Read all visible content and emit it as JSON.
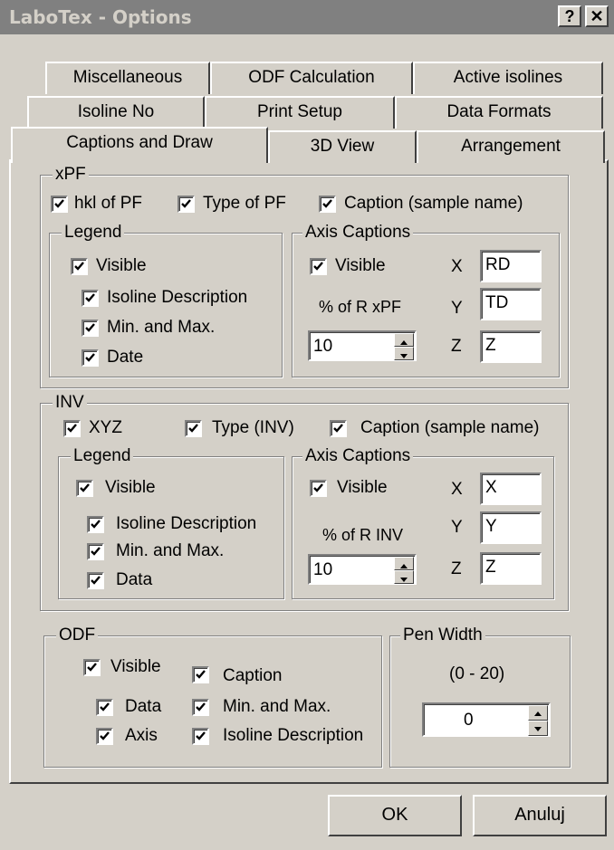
{
  "window": {
    "title": "LaboTex - Options",
    "help_label": "?",
    "close_label": "✕"
  },
  "tabs": {
    "row1": [
      "Miscellaneous",
      "ODF Calculation",
      "Active isolines"
    ],
    "row2": [
      "Isoline No",
      "Print Setup",
      "Data Formats"
    ],
    "row3": [
      "Captions and Draw",
      "3D View",
      "Arrangement"
    ]
  },
  "xpf": {
    "title": "xPF",
    "hkl": "hkl of PF",
    "type": "Type of PF",
    "caption": "Caption (sample name)",
    "legend": {
      "title": "Legend",
      "visible": "Visible",
      "iso": "Isoline Description",
      "minmax": "Min. and Max.",
      "date": "Date"
    },
    "axis": {
      "title": "Axis Captions",
      "visible": "Visible",
      "percent": "% of R xPF",
      "spin_value": "10",
      "x_label": "X",
      "y_label": "Y",
      "z_label": "Z",
      "x_value": "RD",
      "y_value": "TD",
      "z_value": "Z"
    }
  },
  "inv": {
    "title": "INV",
    "xyz": "XYZ",
    "type": "Type (INV)",
    "caption": "Caption (sample name)",
    "legend": {
      "title": "Legend",
      "visible": "Visible",
      "iso": "Isoline Description",
      "minmax": "Min. and Max.",
      "data": "Data"
    },
    "axis": {
      "title": "Axis Captions",
      "visible": "Visible",
      "percent": "% of R INV",
      "spin_value": "10",
      "x_label": "X",
      "y_label": "Y",
      "z_label": "Z",
      "x_value": "X",
      "y_value": "Y",
      "z_value": "Z"
    }
  },
  "odf": {
    "title": "ODF",
    "visible": "Visible",
    "caption": "Caption",
    "data": "Data",
    "minmax": "Min. and Max.",
    "axis": "Axis",
    "iso": "Isoline Description"
  },
  "pen": {
    "title": "Pen Width",
    "range": "(0 - 20)",
    "value": "0"
  },
  "buttons": {
    "ok": "OK",
    "cancel": "Anuluj"
  }
}
